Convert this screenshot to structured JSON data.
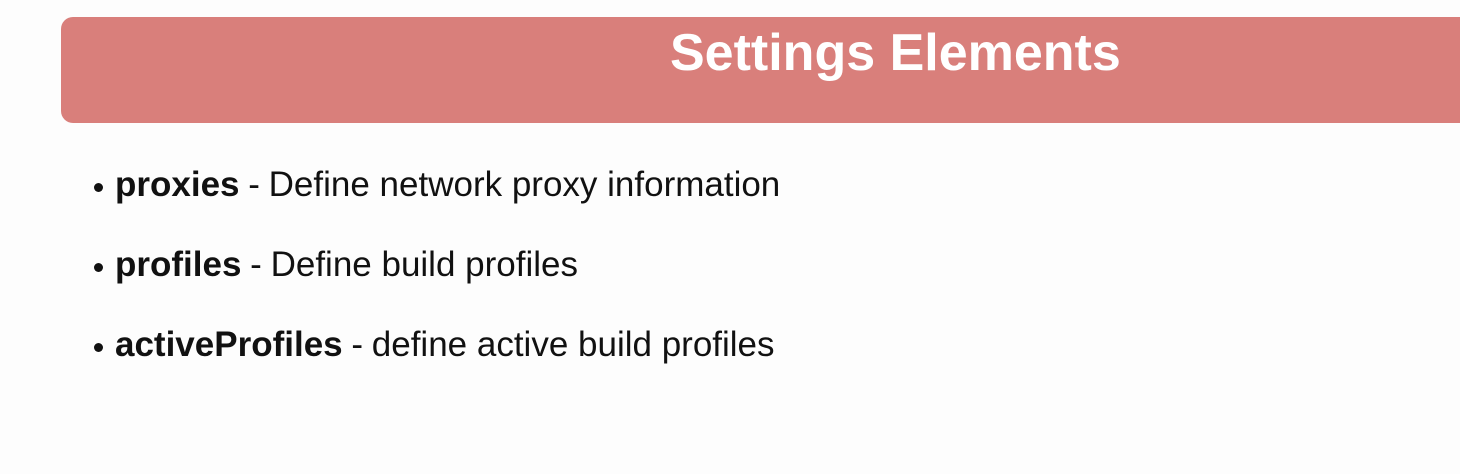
{
  "slide": {
    "title": "Settings Elements",
    "bullets": [
      {
        "term": "proxies",
        "separator": "-",
        "description": "Define network proxy information"
      },
      {
        "term": "profiles",
        "separator": "-",
        "description": "Define build profiles"
      },
      {
        "term": "activeProfiles",
        "separator": "-",
        "description": "define active build profiles"
      }
    ]
  },
  "colors": {
    "banner": "#d97f7b",
    "title_text": "#ffffff",
    "body_text": "#111111",
    "background": "#fdfdfd"
  }
}
